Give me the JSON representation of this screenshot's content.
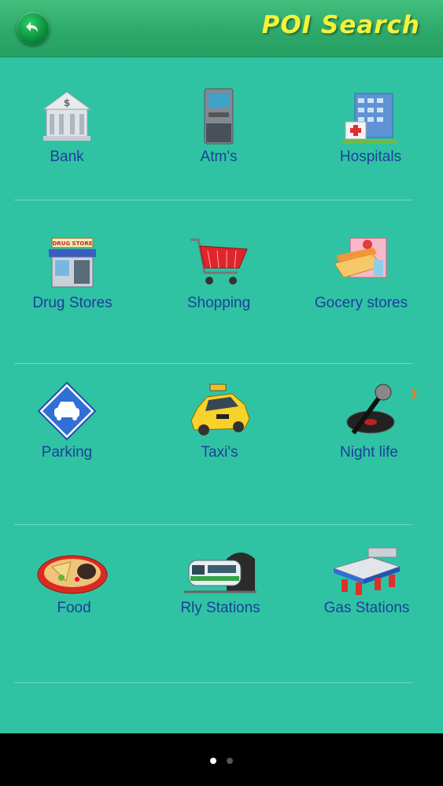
{
  "header": {
    "title": "POI Search",
    "back_icon": "back-arrow-icon"
  },
  "categories": [
    {
      "label": "Bank",
      "icon": "bank-icon"
    },
    {
      "label": "Atm's",
      "icon": "atm-icon"
    },
    {
      "label": "Hospitals",
      "icon": "hospital-icon"
    },
    {
      "label": "Drug Stores",
      "icon": "drug-store-icon"
    },
    {
      "label": "Shopping",
      "icon": "shopping-cart-icon"
    },
    {
      "label": "Gocery stores",
      "icon": "grocery-store-icon"
    },
    {
      "label": "Parking",
      "icon": "parking-icon"
    },
    {
      "label": "Taxi's",
      "icon": "taxi-icon"
    },
    {
      "label": "Night life",
      "icon": "microphone-icon"
    },
    {
      "label": "Food",
      "icon": "food-icon"
    },
    {
      "label": "Rly Stations",
      "icon": "train-icon"
    },
    {
      "label": "Gas Stations",
      "icon": "gas-station-icon"
    }
  ],
  "pager": {
    "pages": 2,
    "current": 1
  },
  "colors": {
    "background": "#2fc3a4",
    "header": "#2da96a",
    "title": "#f5f23a",
    "label": "#1d3f9a",
    "arrow": "#f07a18"
  }
}
